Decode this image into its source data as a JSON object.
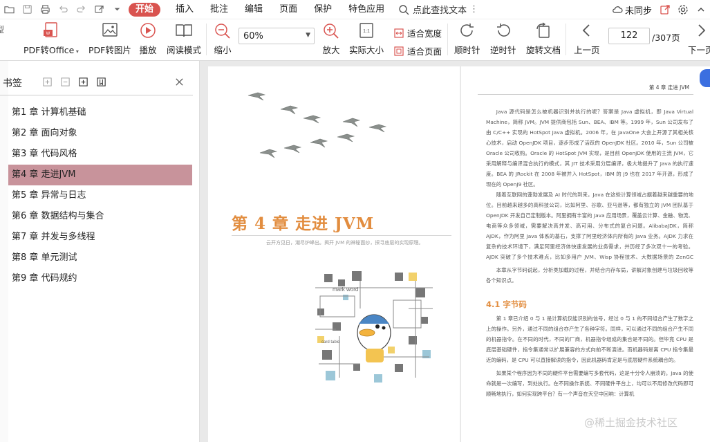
{
  "menubar": {
    "quick_icons": [
      "folder-icon",
      "save-icon",
      "print-icon",
      "undo-icon",
      "redo-icon",
      "share-icon",
      "dropdown-icon"
    ],
    "items": [
      {
        "label": "开始",
        "active": true
      },
      {
        "label": "插入"
      },
      {
        "label": "批注"
      },
      {
        "label": "编辑"
      },
      {
        "label": "页面"
      },
      {
        "label": "保护"
      },
      {
        "label": "特色应用"
      }
    ],
    "search_label": "点此查找文本",
    "sync_label": "未同步",
    "accent_color": "#d9534f"
  },
  "ribbon": {
    "pdf_to_office": "PDF转Office",
    "pdf_to_image": "PDF转图片",
    "play": "播放",
    "read_mode": "阅读模式",
    "zoom_out": "缩小",
    "zoom_value": "60%",
    "zoom_in": "放大",
    "actual_size": "实际大小",
    "fit_width": "适合宽度",
    "fit_page": "适合页面",
    "rotate_cw": "顺时针",
    "rotate_ccw": "逆时针",
    "rotate_doc": "旋转文档",
    "prev_page": "上一页",
    "next_page": "下一页",
    "current_page": "122",
    "total_pages": "/307页"
  },
  "sidebar": {
    "title": "书签",
    "toc": [
      {
        "label": "第1 章 计算机基础"
      },
      {
        "label": "第2 章 面向对象"
      },
      {
        "label": "第3 章 代码风格"
      },
      {
        "label": "第4 章 走进JVM",
        "selected": true
      },
      {
        "label": "第5 章 异常与日志"
      },
      {
        "label": "第6 章 数据结构与集合"
      },
      {
        "label": "第7 章 并发与多线程"
      },
      {
        "label": "第8 章 单元测试"
      },
      {
        "label": "第9 章 代码规约"
      }
    ],
    "selected_color": "#c8939b"
  },
  "document": {
    "left_page": {
      "chapter_title": "第 4 章  走进 JVM",
      "chapter_subtitle": "云开方见日，潮尽炉峰出。揭开 JVM 的神秘面纱，探寻底层的实现原理。",
      "illustration_texts": [
        "mark word",
        "card table"
      ],
      "title_color": "#e28d3f"
    },
    "right_page": {
      "running_head": "第 4 章   走进 JVM",
      "paragraphs": [
        "Java 源代码是怎么被机器识别并执行的呢？答案是 Java 虚拟机，即 Java Virtual Machine，简称 JVM。JVM 提供商包括 Sun、BEA、IBM 等。1999 年，Sun 公司发布了由 C/C++ 实现的 HotSpot Java 虚拟机。2006 年，在 JavaOne 大会上开源了其相关核心技术，启动 OpenJDK 项目，逐步形成了活跃的 OpenJDK 社区。2010 年，Sun 公司被 Oracle 公司收购。Oracle 的 HotSpot JVM 实现，是目前 OpenJDK 使用的主流 JVM，它采用解释与编译混合执行的模式，其 JIT 技术采用分层编译，极大地提升了 Java 的执行速度。BEA 的 JRockit 在 2008 年被并入 HotSpot，IBM 的 J9 也在 2017 年开源，形成了现在的 OpenJ9 社区。",
        "随着互联网的蓬勃发展及 AI 时代的到来，Java 在这些计算领域占据着越来越重要的地位。目前越来越多的高科技公司，比如阿里、谷歌、亚马逊等，都有独立的 JVM 团队基于 OpenJDK 开发自己定制版本。阿里拥有丰富的 Java 应用场景，覆盖云计算、金融、物流、电商等众多领域，需要解决高并发、高可用、分布式的复合问题。AlibabaJDK，简称 AJDK，作为阿里 Java 体系的基石，支撑了阿里经济体内所有的 Java 业务。AJDK 力求在复杂的技术环境下，满足阿里经济体快速发展的业务需求，并历经了多次双十一的考验。AJDK 突破了多个技术难点，比如多用户 JVM、Wisp 协程技术、大数据场景的 ZenGC 等。",
        "本章从字节码说起，分析类加载的过程，并结合内存布局，讲解对象创建与垃圾回收等各个知识点。"
      ],
      "section_heading": "4.1   字节码",
      "section_paragraphs": [
        "第 1 章已介绍 0 与 1 是计算机仅能识别的信号，经过 0 与 1 的不同组合产生了数字之上的操作。另外，通过不同的组合亦产生了各种字符。同样，可以通过不同的组合产生不同的机器指令。在不同的时代，不同的厂商，机器指令组成的集合是不同的。但毕竟 CPU 是底层基础硬件，指令集通常以扩展兼容的方式向前不断演进。而机器码是离 CPU 指令集最近的编码，是 CPU 可以直接解读的指令，因此机器码肯定是与底层硬件系统耦合的。",
        "如果某个程序因为不同的硬件平台需要编写多套代码，这是十分令人崩溃的。Java 的使命就是一次编写，到处执行。在不同操作系统、不同硬件平台上，均可以不用修改代码即可顺畅地执行，如何实现跨平台？有一个声音在天空中回响：计算机"
      ]
    }
  },
  "watermark": "@稀土掘金技术社区"
}
